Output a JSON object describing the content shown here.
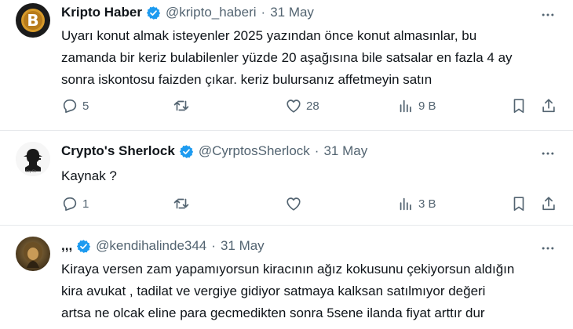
{
  "tweets": [
    {
      "name": "Kripto Haber",
      "handle": "@kripto_haberi",
      "separator": "·",
      "date": "31 May",
      "lines": [
        "Uyarı konut almak isteyenler 2025 yazından önce konut almasınlar, bu",
        "zamanda bir keriz bulabilenler yüzde 20 aşağısına bile satsalar en fazla 4 ay",
        "sonra iskontosu faizden çıkar. keriz bulursanız affetmeyin satın"
      ],
      "replies": "5",
      "retweets": "",
      "likes": "28",
      "views": "9 B"
    },
    {
      "name": "Crypto's Sherlock",
      "handle": "@CyrptosSherlock",
      "separator": "·",
      "date": "31 May",
      "lines": [
        "Kaynak ?"
      ],
      "replies": "1",
      "retweets": "",
      "likes": "",
      "views": "3 B"
    },
    {
      "name": ",,,",
      "handle": "@kendihalinde344",
      "separator": "·",
      "date": "31 May",
      "lines": [
        "Kiraya versen zam yapamıyorsun kiracının ağız kokusunu çekiyorsun aldığın",
        "kira avukat , tadilat ve vergiye gidiyor satmaya kalksan satılmıyor değeri",
        "artsa ne olcak eline para gecmedikten sonra 5sene ilanda fiyat arttır dur"
      ]
    }
  ],
  "colors": {
    "verified": "#1d9bf0",
    "text": "#0f1419",
    "muted": "#536471"
  }
}
